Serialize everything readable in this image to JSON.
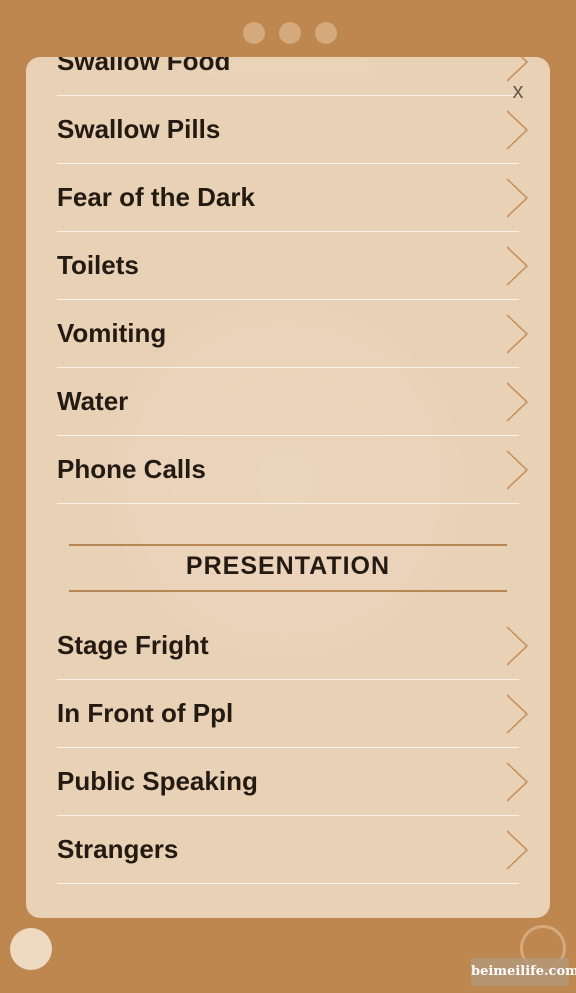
{
  "modal": {
    "close_label": "x"
  },
  "list_top": [
    {
      "label": "Swallow Food"
    },
    {
      "label": "Swallow Pills"
    },
    {
      "label": "Fear of the Dark"
    },
    {
      "label": "Toilets"
    },
    {
      "label": "Vomiting"
    },
    {
      "label": "Water"
    },
    {
      "label": "Phone Calls"
    }
  ],
  "section": {
    "title": "PRESENTATION"
  },
  "list_bottom": [
    {
      "label": "Stage Fright"
    },
    {
      "label": "In Front of Ppl"
    },
    {
      "label": "Public Speaking"
    },
    {
      "label": "Strangers"
    }
  ],
  "watermark": "beimeilife.com",
  "colors": {
    "background": "#bd874f",
    "accent": "#b98655",
    "text": "#231a12"
  }
}
